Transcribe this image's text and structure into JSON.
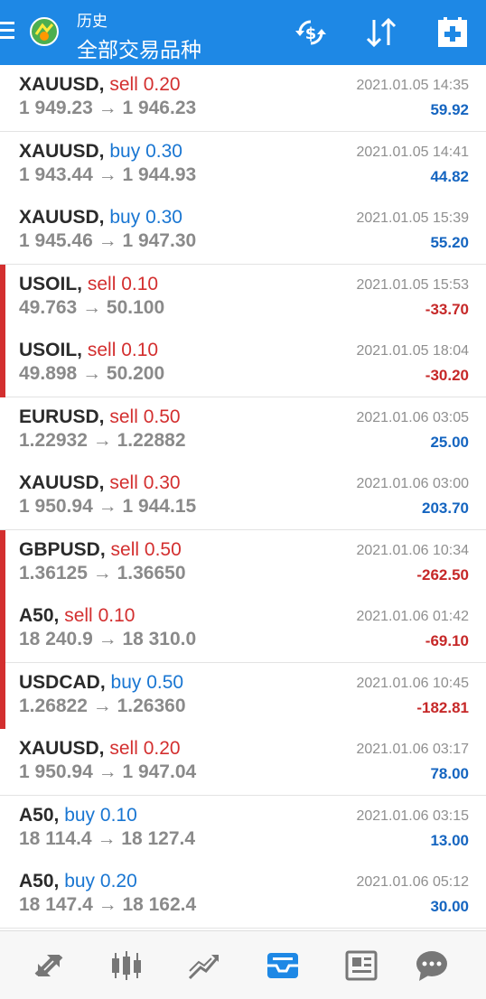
{
  "header": {
    "subtitle": "历史",
    "title": "全部交易品种",
    "icons": [
      "menu-icon",
      "app-logo-icon",
      "currency-exchange-icon",
      "sort-icon",
      "add-deposit-icon"
    ]
  },
  "colors": {
    "header": "#1e88e5",
    "sell": "#d32f2f",
    "buy": "#1976d2",
    "loss": "#c62828",
    "profit": "#1565c0",
    "loss_marker": "#d32f2f"
  },
  "trades": [
    {
      "symbol": "XAUUSD,",
      "side": "sell",
      "volume": "0.20",
      "open": "1 949.23",
      "close": "1 946.23",
      "time": "2021.01.05 14:35",
      "profit": "59.92"
    },
    {
      "symbol": "XAUUSD,",
      "side": "buy",
      "volume": "0.30",
      "open": "1 943.44",
      "close": "1 944.93",
      "time": "2021.01.05 14:41",
      "profit": "44.82"
    },
    {
      "symbol": "XAUUSD,",
      "side": "buy",
      "volume": "0.30",
      "open": "1 945.46",
      "close": "1 947.30",
      "time": "2021.01.05 15:39",
      "profit": "55.20"
    },
    {
      "symbol": "USOIL,",
      "side": "sell",
      "volume": "0.10",
      "open": "49.763",
      "close": "50.100",
      "time": "2021.01.05 15:53",
      "profit": "-33.70"
    },
    {
      "symbol": "USOIL,",
      "side": "sell",
      "volume": "0.10",
      "open": "49.898",
      "close": "50.200",
      "time": "2021.01.05 18:04",
      "profit": "-30.20"
    },
    {
      "symbol": "EURUSD,",
      "side": "sell",
      "volume": "0.50",
      "open": "1.22932",
      "close": "1.22882",
      "time": "2021.01.06 03:05",
      "profit": "25.00"
    },
    {
      "symbol": "XAUUSD,",
      "side": "sell",
      "volume": "0.30",
      "open": "1 950.94",
      "close": "1 944.15",
      "time": "2021.01.06 03:00",
      "profit": "203.70"
    },
    {
      "symbol": "GBPUSD,",
      "side": "sell",
      "volume": "0.50",
      "open": "1.36125",
      "close": "1.36650",
      "time": "2021.01.06 10:34",
      "profit": "-262.50"
    },
    {
      "symbol": "A50,",
      "side": "sell",
      "volume": "0.10",
      "open": "18 240.9",
      "close": "18 310.0",
      "time": "2021.01.06 01:42",
      "profit": "-69.10"
    },
    {
      "symbol": "USDCAD,",
      "side": "buy",
      "volume": "0.50",
      "open": "1.26822",
      "close": "1.26360",
      "time": "2021.01.06 10:45",
      "profit": "-182.81"
    },
    {
      "symbol": "XAUUSD,",
      "side": "sell",
      "volume": "0.20",
      "open": "1 950.94",
      "close": "1 947.04",
      "time": "2021.01.06 03:17",
      "profit": "78.00"
    },
    {
      "symbol": "A50,",
      "side": "buy",
      "volume": "0.10",
      "open": "18 114.4",
      "close": "18 127.4",
      "time": "2021.01.06 03:15",
      "profit": "13.00"
    },
    {
      "symbol": "A50,",
      "side": "buy",
      "volume": "0.20",
      "open": "18 147.4",
      "close": "18 162.4",
      "time": "2021.01.06 05:12",
      "profit": "30.00"
    }
  ],
  "bottom_nav": {
    "items": [
      "quotes-icon",
      "chart-icon",
      "trade-icon",
      "history-icon",
      "news-icon",
      "chat-icon"
    ],
    "active": "history-icon"
  }
}
